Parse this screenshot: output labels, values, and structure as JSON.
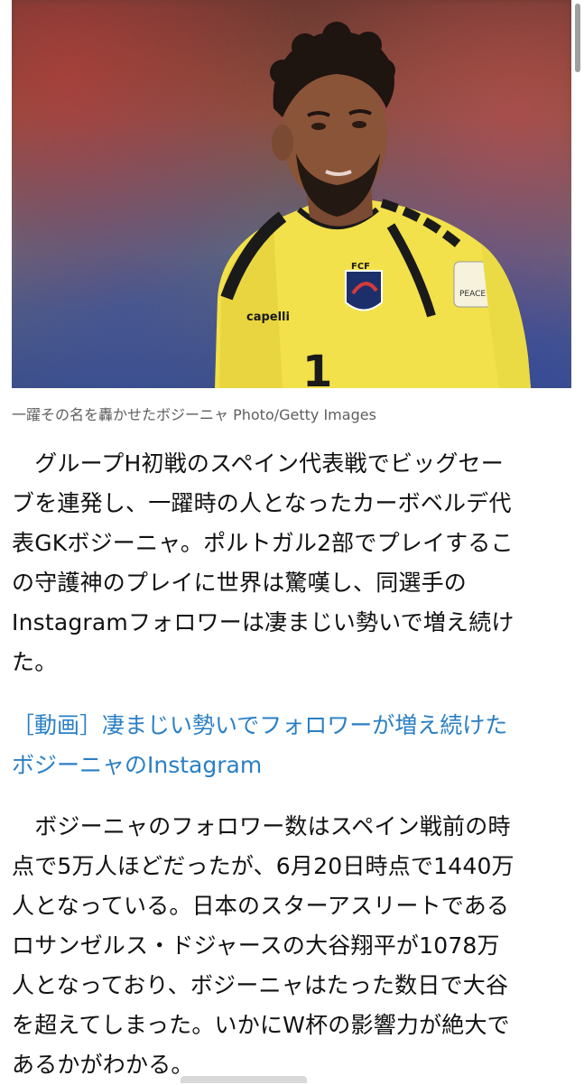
{
  "photo": {
    "alt_icon": "player-photo",
    "shirt_number": "1",
    "crest_text": "FCF",
    "sponsor_text": "capelli",
    "patch_text": "PEACE"
  },
  "caption": "一躍その名を轟かせたボジーニャ Photo/Getty Images",
  "paragraph1": {
    "lines": [
      "　グループH初戦のスペイン代表戦でビッグセー",
      "ブを連発し、一躍時の人となったカーボベルデ代",
      "表GKボジーニャ。ポルトガル2部でプレイするこ",
      "の守護神のプレイに世界は驚嘆し、同選手の",
      "Instagramフォロワーは凄まじい勢いで増え続け",
      "た。"
    ]
  },
  "link": {
    "lines": [
      "［動画］凄まじい勢いでフォロワーが増え続けた",
      "ボジーニャのInstagram"
    ]
  },
  "paragraph2": {
    "lines": [
      "　ボジーニャのフォロワー数はスペイン戦前の時",
      "点で5万人ほどだったが、6月20日時点で1440万",
      "人となっている。日本のスターアスリートである",
      "ロサンゼルス・ドジャースの大谷翔平が1078万",
      "人となっており、ボジーニャはたった数日で大谷",
      "を超えてしまった。いかにW杯の影響力が絶大で",
      "あるかがわかる。"
    ]
  },
  "colors": {
    "link": "#2a7fc4",
    "text": "#111111",
    "caption": "#5e5e5e",
    "jersey": "#f2e14a"
  }
}
